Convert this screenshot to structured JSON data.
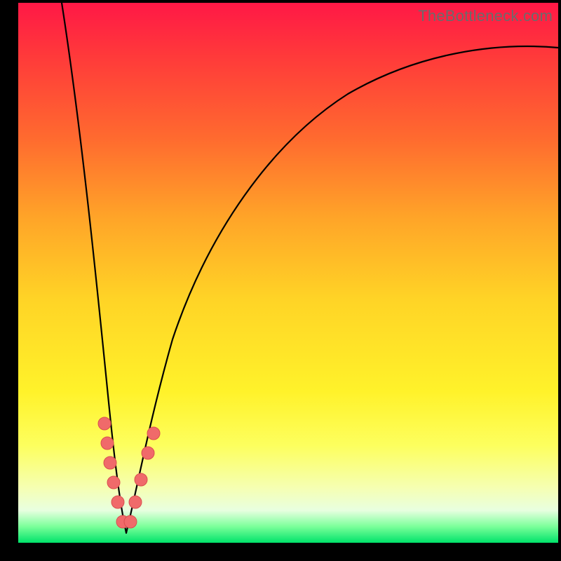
{
  "watermark": "TheBottleneck.com",
  "colors": {
    "background_black": "#000000",
    "bead": "#f06a6a",
    "bead_stroke": "#d94f4f",
    "curve": "#000000",
    "gradient_top": "#ff1846",
    "gradient_bottom": "#00e36a"
  },
  "chart_data": {
    "type": "line",
    "title": "",
    "xlabel": "",
    "ylabel": "",
    "xlim": [
      0,
      100
    ],
    "ylim": [
      0,
      100
    ],
    "notch_x": 20,
    "series": [
      {
        "name": "left-branch",
        "x": [
          8,
          10,
          12,
          14,
          16,
          17,
          18,
          19,
          20
        ],
        "values": [
          100,
          80,
          60,
          40,
          22,
          14,
          8,
          3,
          0
        ]
      },
      {
        "name": "right-branch",
        "x": [
          20,
          22,
          24,
          26,
          30,
          36,
          44,
          54,
          66,
          80,
          94,
          100
        ],
        "values": [
          0,
          8,
          18,
          28,
          43,
          58,
          70,
          78,
          84,
          88,
          90,
          91
        ]
      }
    ],
    "markers": [
      {
        "branch": "left",
        "x": 16.0,
        "y": 22
      },
      {
        "branch": "left",
        "x": 16.8,
        "y": 16
      },
      {
        "branch": "left",
        "x": 17.5,
        "y": 11
      },
      {
        "branch": "left",
        "x": 18.2,
        "y": 7
      },
      {
        "branch": "left",
        "x": 18.9,
        "y": 3.5
      },
      {
        "branch": "left",
        "x": 19.5,
        "y": 1.2
      },
      {
        "branch": "right",
        "x": 20.6,
        "y": 1.4
      },
      {
        "branch": "right",
        "x": 21.4,
        "y": 4.5
      },
      {
        "branch": "right",
        "x": 22.4,
        "y": 9
      },
      {
        "branch": "right",
        "x": 23.6,
        "y": 15
      },
      {
        "branch": "right",
        "x": 24.4,
        "y": 19
      }
    ]
  }
}
